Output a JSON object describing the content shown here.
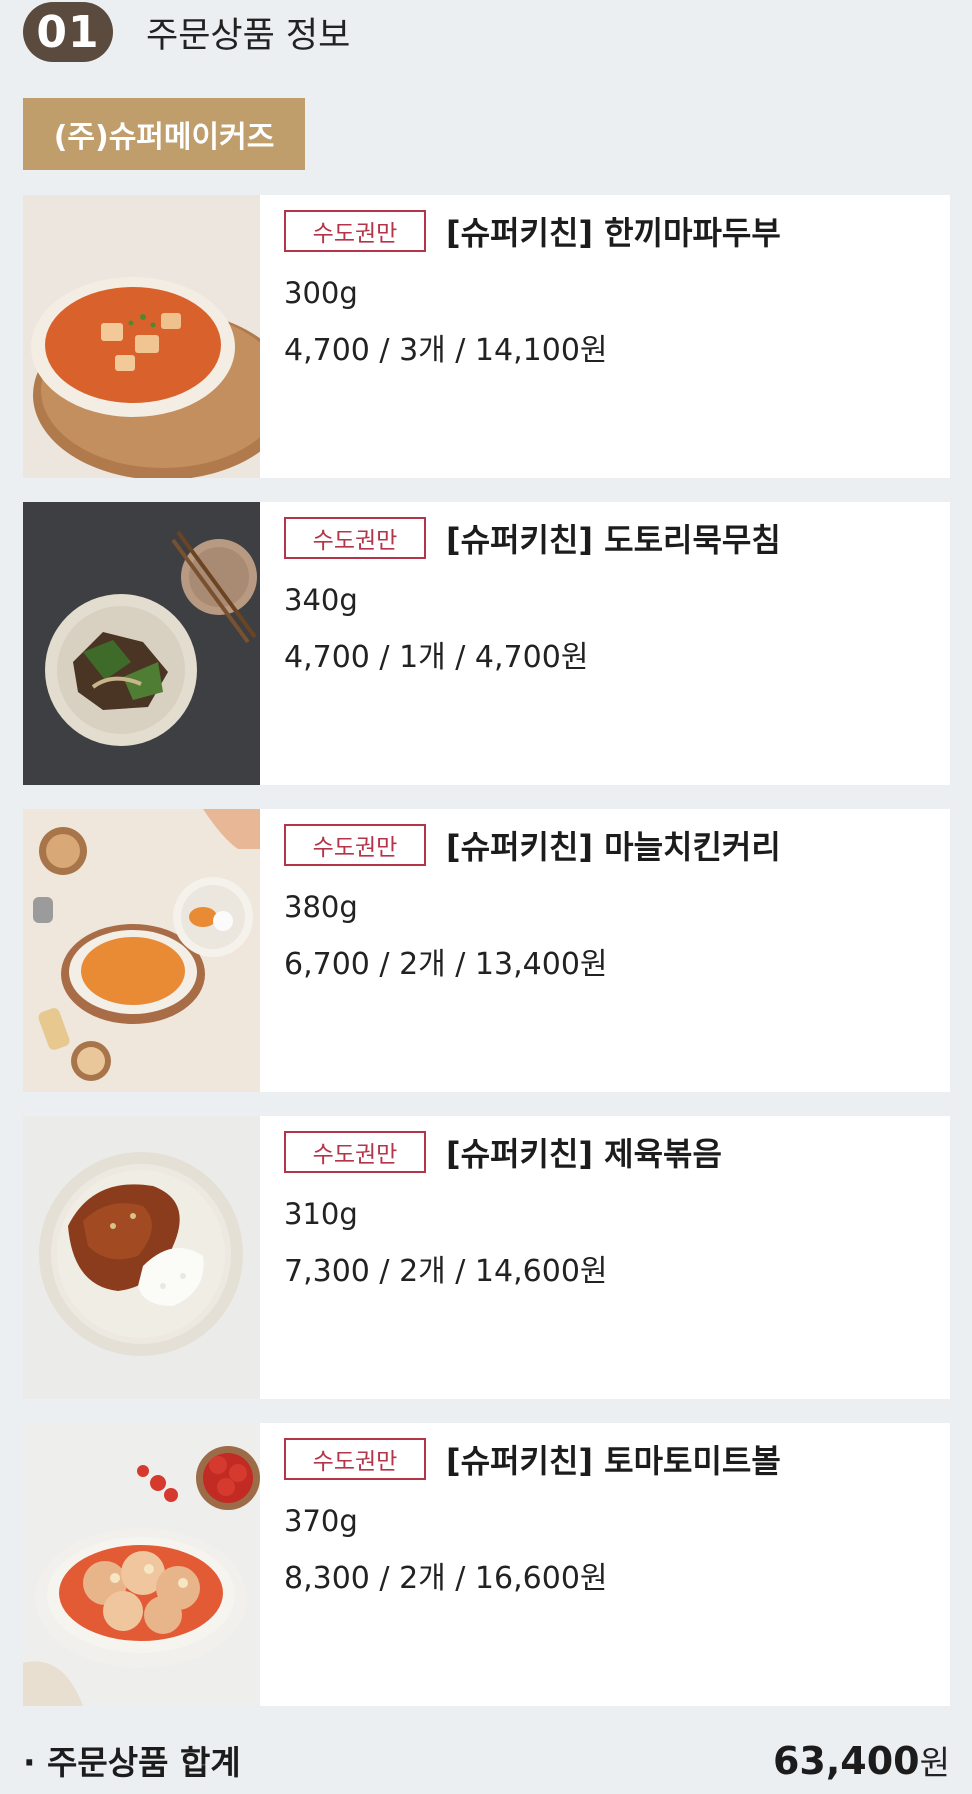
{
  "section": {
    "step": "01",
    "title": "주문상품 정보"
  },
  "seller": {
    "name": "(주)슈퍼메이커즈"
  },
  "items": [
    {
      "region": "수도권만",
      "name": "[슈퍼키친] 한끼마파두부",
      "weight": "300g",
      "price_line": "4,700 / 3개 / 14,100원",
      "photo": "mapo-tofu-photo"
    },
    {
      "region": "수도권만",
      "name": "[슈퍼키친] 도토리묵무침",
      "weight": "340g",
      "price_line": "4,700 / 1개 / 4,700원",
      "photo": "acorn-jelly-salad-photo"
    },
    {
      "region": "수도권만",
      "name": "[슈퍼키친] 마늘치킨커리",
      "weight": "380g",
      "price_line": "6,700 / 2개 / 13,400원",
      "photo": "garlic-chicken-curry-photo"
    },
    {
      "region": "수도권만",
      "name": "[슈퍼키친] 제육볶음",
      "weight": "310g",
      "price_line": "7,300 / 2개 / 14,600원",
      "photo": "spicy-pork-photo"
    },
    {
      "region": "수도권만",
      "name": "[슈퍼키친] 토마토미트볼",
      "weight": "370g",
      "price_line": "8,300 / 2개 / 16,600원",
      "photo": "tomato-meatball-photo"
    }
  ],
  "total": {
    "label": "· 주문상품 합계",
    "amount": "63,400",
    "unit": "원"
  },
  "colors": {
    "badge_bg": "#5b4a3e",
    "seller_bg": "#bf9e6b",
    "region_accent": "#b4344a",
    "page_bg": "#eceff1"
  }
}
